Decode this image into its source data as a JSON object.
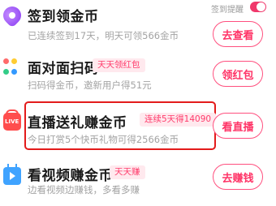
{
  "reminder": {
    "label": "签到提醒",
    "enabled": true
  },
  "tasks": [
    {
      "title": "签到领金币",
      "tag": "",
      "desc": "已连续签到17天，明天可领566金币",
      "button": "去查看",
      "icon": "sign-in-icon"
    },
    {
      "title": "面对面扫码",
      "tag": "天天领红包",
      "desc": "扫码得金币，邀新用户得51元",
      "button": "领红包",
      "icon": "scan-icon"
    },
    {
      "title": "直播送礼赚金币",
      "tag": "连续5天得14090",
      "desc": "今日打赏5个快币礼物可得2566金币",
      "button": "看直播",
      "icon": "live-icon"
    },
    {
      "title": "看视频赚金币",
      "tag": "天天赚",
      "desc": "边看视频边赚钱，多看多赚",
      "button": "去赚钱",
      "icon": "video-icon"
    }
  ],
  "live_icon_text": "LIVE",
  "colors": {
    "accent": "#ff3366",
    "highlight_border": "#e31b1b",
    "tag_bg": "#ffe9ee"
  }
}
